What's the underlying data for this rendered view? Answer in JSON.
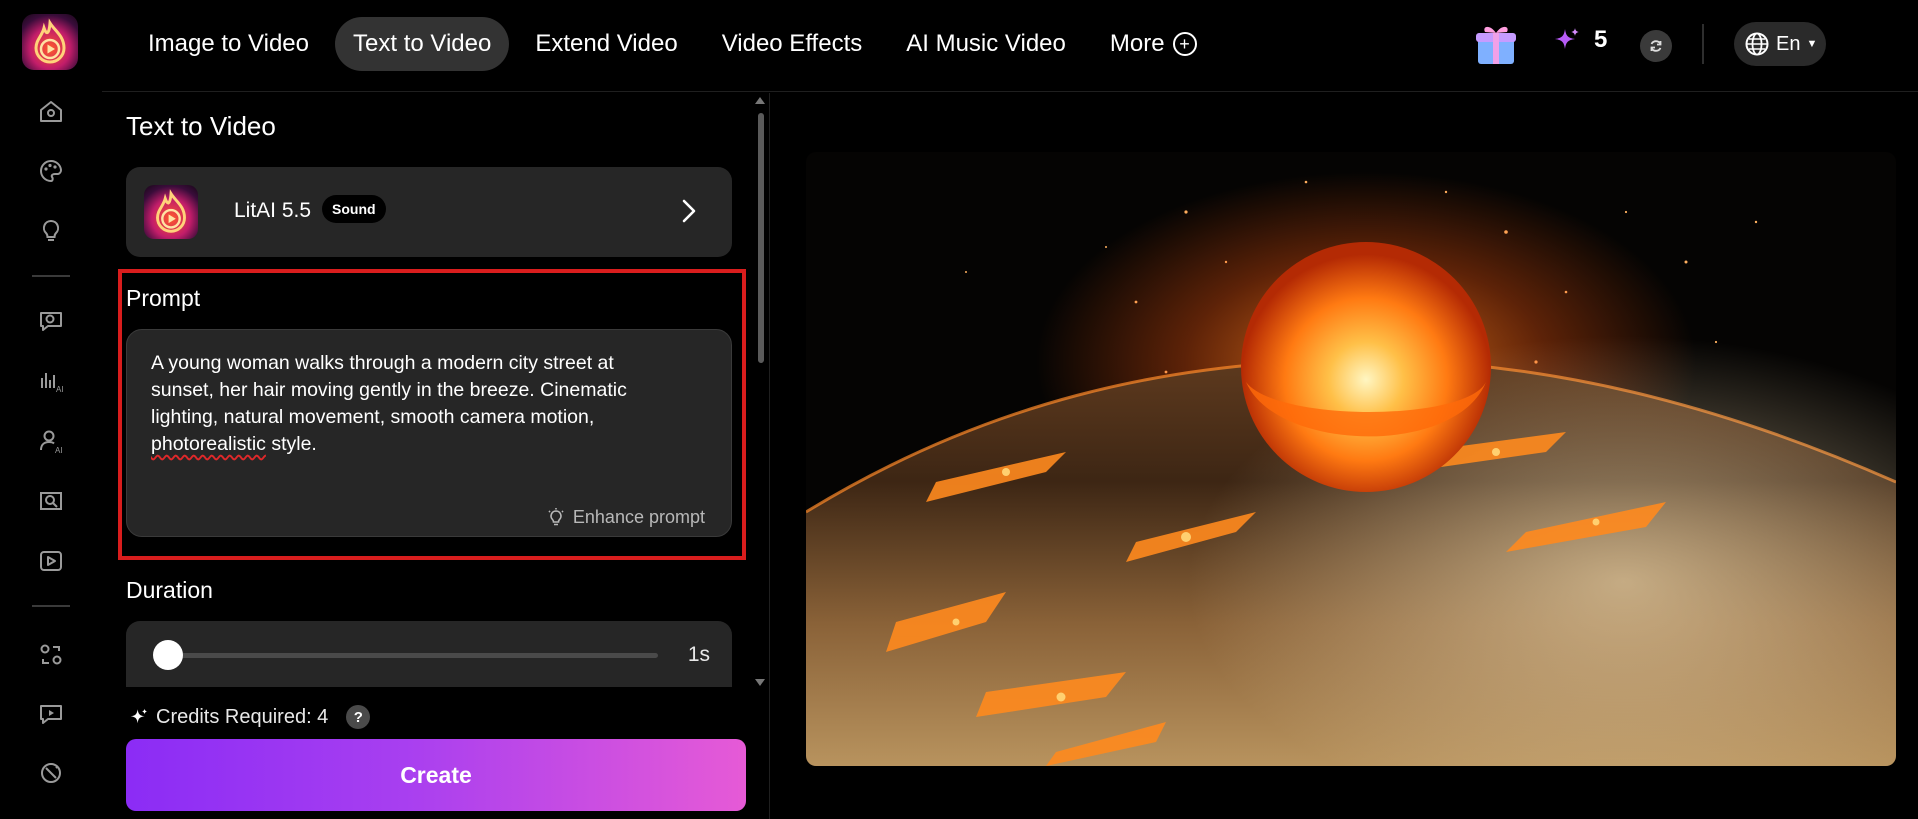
{
  "nav": {
    "items": [
      {
        "label": "Image to Video",
        "active": false
      },
      {
        "label": "Text to Video",
        "active": true
      },
      {
        "label": "Extend Video",
        "active": false
      },
      {
        "label": "Video Effects",
        "active": false
      },
      {
        "label": "AI Music Video",
        "active": false
      },
      {
        "label": "More",
        "active": false
      }
    ]
  },
  "header": {
    "credit_count": "5",
    "language": "En"
  },
  "panel": {
    "title": "Text to Video",
    "model": {
      "name": "LitAI 5.5",
      "badge": "Sound"
    },
    "prompt": {
      "label": "Prompt",
      "value_lines": [
        "A young woman walks through a modern city street at",
        "sunset, her hair moving gently in the breeze. Cinematic",
        "lighting, natural movement, smooth camera motion,"
      ],
      "value_last_word": "photorealistic",
      "value_tail": " style.",
      "enhance_label": "Enhance prompt"
    },
    "duration": {
      "label": "Duration",
      "value": "1s",
      "position": 0.0
    },
    "credits_required": "Credits Required: 4",
    "help_label": "?",
    "create_label": "Create"
  },
  "colors": {
    "accent_purple": "#8b2cf5",
    "accent_pink": "#e65ad6",
    "highlight_red": "#d91d1d",
    "active_nav_bg": "#333333"
  },
  "icons": {
    "rail": [
      "home-icon",
      "palette-icon",
      "lightbulb-icon",
      "chat-video-icon",
      "audio-bars-ai-icon",
      "person-ai-icon",
      "image-search-icon",
      "video-play-icon",
      "swap-person-icon",
      "photo-video-icon",
      "dance-icon"
    ]
  }
}
